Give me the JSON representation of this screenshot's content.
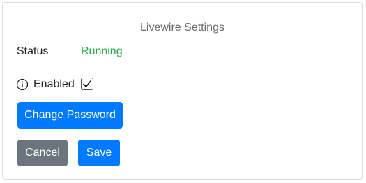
{
  "title": "Livewire Settings",
  "status": {
    "label": "Status",
    "value": "Running"
  },
  "enabled": {
    "label": "Enabled",
    "checked": true,
    "info_icon": "info-icon"
  },
  "buttons": {
    "change_password": "Change Password",
    "cancel": "Cancel",
    "save": "Save"
  },
  "colors": {
    "primary": "#007bff",
    "secondary": "#6c757d",
    "status_running": "#28a745",
    "title": "#6c6c6c"
  }
}
